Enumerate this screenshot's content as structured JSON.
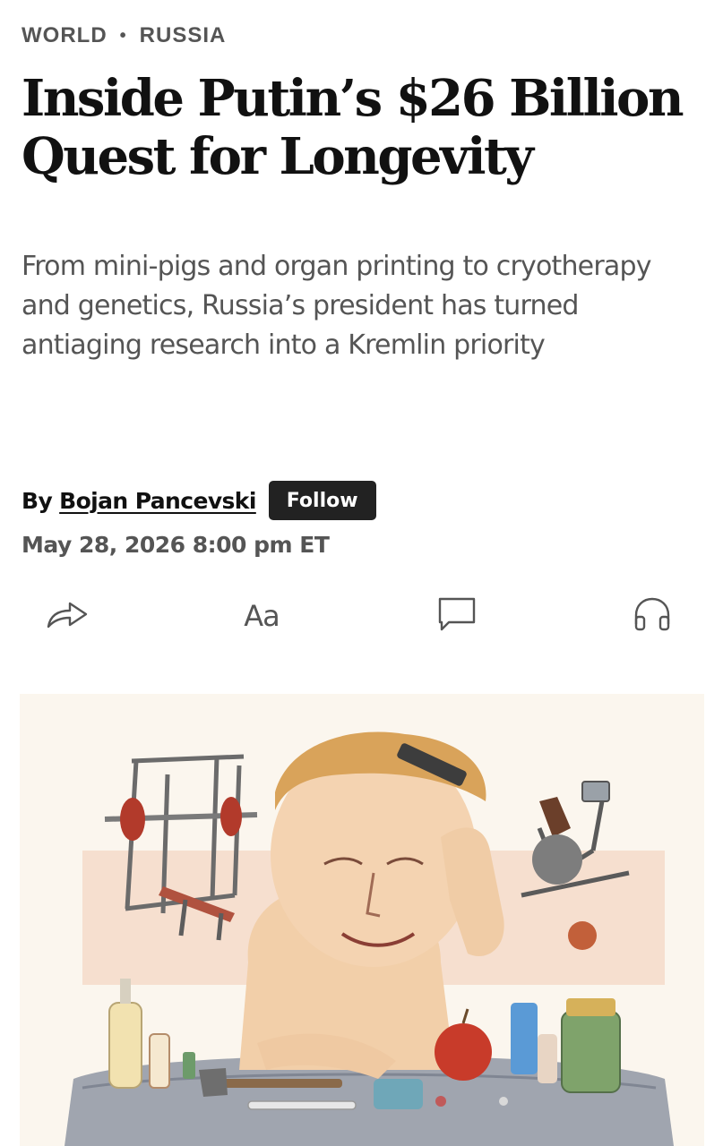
{
  "breadcrumb": {
    "section": "WORLD",
    "subsection": "RUSSIA"
  },
  "headline": "Inside Putin’s $26 Billion Quest for Longevity",
  "dek": "From mini-pigs and organ printing to cryotherapy and genetics, Russia’s president has turned antiaging research into a Kremlin priority",
  "byline": {
    "prefix": "By",
    "author": "Bojan Pancevski",
    "follow_label": "Follow"
  },
  "timestamp": "May 28, 2026 8:00 pm ET",
  "toolbar": {
    "share_icon": "share-icon",
    "text_size_label": "Aa",
    "comment_icon": "comment-icon",
    "listen_icon": "headphones-icon"
  },
  "colors": {
    "text": "#111111",
    "muted": "#555555",
    "button_bg": "#222222",
    "button_text": "#ffffff",
    "illustration_bg": "#fbf6ee"
  }
}
